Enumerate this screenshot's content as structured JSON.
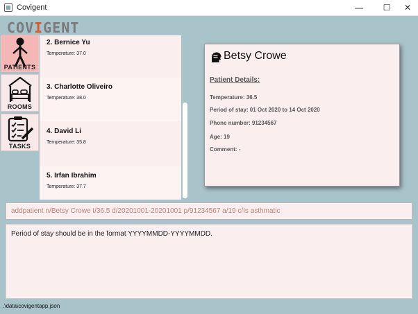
{
  "window": {
    "title": "Covigent",
    "minimize_icon": "minimize-icon",
    "maximize_icon": "maximize-icon",
    "close_icon": "close-icon"
  },
  "logo": {
    "text_pre": "COV",
    "text_mid": "I",
    "text_post": "GENT"
  },
  "sidebar": {
    "items": [
      {
        "label": "PATIENTS",
        "icon": "person-icon",
        "active": true
      },
      {
        "label": "ROOMS",
        "icon": "bed-icon",
        "active": false
      },
      {
        "label": "TASKS",
        "icon": "checklist-icon",
        "active": false
      }
    ]
  },
  "patients": [
    {
      "name": "2.  Bernice Yu",
      "temp": "Temperature: 37.0"
    },
    {
      "name": "3.  Charlotte Oliveiro",
      "temp": "Temperature: 38.0"
    },
    {
      "name": "4.  David Li",
      "temp": "Temperature: 35.8"
    },
    {
      "name": "5.  Irfan Ibrahim",
      "temp": "Temperature: 37.7"
    }
  ],
  "detail": {
    "name": "Betsy Crowe",
    "section": "Patient Details:",
    "temperature": "Temperature: 36.5",
    "stay": "Period of stay: 01 Oct 2020 to 14 Oct 2020",
    "phone": "Phone number: 91234567",
    "age": "Age: 19",
    "comment": "Comment: -"
  },
  "command": {
    "value": "addpatient n/Betsy Crowe t/36.5 d/20201001-20201001 p/91234567 a/19 c/Is asthmatic"
  },
  "result": {
    "message": "Period of stay should be in the format YYYYMMDD-YYYYMMDD."
  },
  "status": {
    "path": ".\\data\\covigentapp.json"
  },
  "colors": {
    "background": "#a9c3ca",
    "panel": "#fbeeee",
    "active_tab": "#f4b7b6",
    "command_text": "#c0807a"
  }
}
